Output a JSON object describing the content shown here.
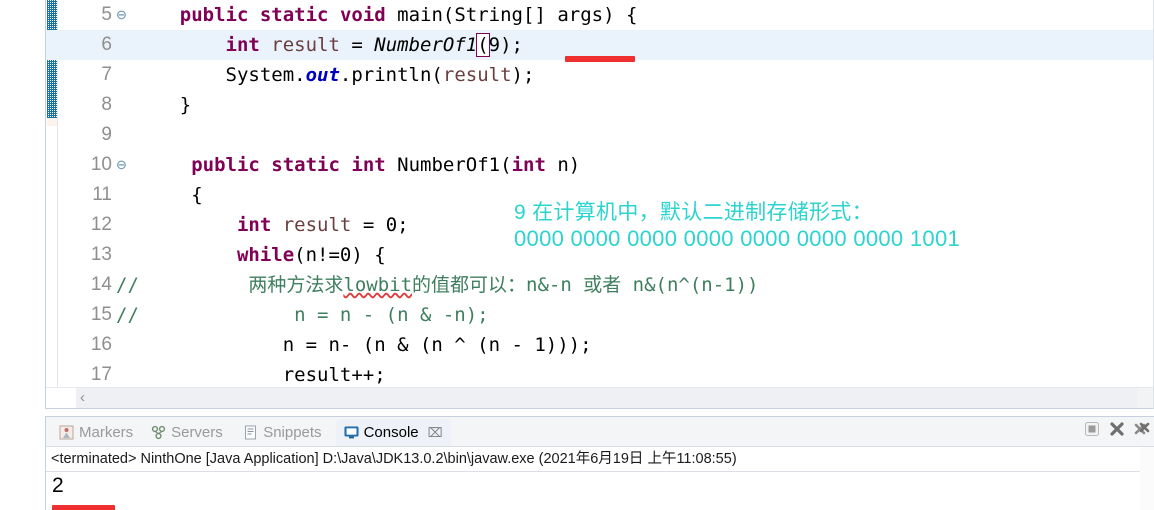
{
  "editor": {
    "lines": [
      {
        "num": "5",
        "fold": "⊖",
        "comment_slashes": "",
        "highlight": false,
        "tokens": [
          {
            "t": "    ",
            "c": "pln"
          },
          {
            "t": "public",
            "c": "kw"
          },
          {
            "t": " ",
            "c": "pln"
          },
          {
            "t": "static",
            "c": "kw"
          },
          {
            "t": " ",
            "c": "pln"
          },
          {
            "t": "void",
            "c": "kw"
          },
          {
            "t": " ",
            "c": "pln"
          },
          {
            "t": "main(String[] args) {",
            "c": "pln"
          }
        ]
      },
      {
        "num": "6",
        "fold": "",
        "comment_slashes": "",
        "highlight": true,
        "tokens": [
          {
            "t": "        ",
            "c": "pln"
          },
          {
            "t": "int",
            "c": "kw"
          },
          {
            "t": " ",
            "c": "pln"
          },
          {
            "t": "result",
            "c": "lvar"
          },
          {
            "t": " = ",
            "c": "pln"
          },
          {
            "t": "NumberOf1",
            "c": "mth"
          },
          {
            "t": "(",
            "c": "pln brk-box"
          },
          {
            "t": "9);",
            "c": "pln"
          }
        ]
      },
      {
        "num": "7",
        "fold": "",
        "comment_slashes": "",
        "highlight": false,
        "tokens": [
          {
            "t": "        System.",
            "c": "pln"
          },
          {
            "t": "out",
            "c": "fld"
          },
          {
            "t": ".println(",
            "c": "pln"
          },
          {
            "t": "result",
            "c": "lvar"
          },
          {
            "t": ");",
            "c": "pln"
          }
        ]
      },
      {
        "num": "8",
        "fold": "",
        "comment_slashes": "",
        "highlight": false,
        "tokens": [
          {
            "t": "    }",
            "c": "pln"
          }
        ]
      },
      {
        "num": "9",
        "fold": "",
        "comment_slashes": "",
        "highlight": false,
        "tokens": [
          {
            "t": "",
            "c": "pln"
          }
        ]
      },
      {
        "num": "10",
        "fold": "⊖",
        "comment_slashes": "",
        "highlight": false,
        "tokens": [
          {
            "t": "     ",
            "c": "pln"
          },
          {
            "t": "public",
            "c": "kw"
          },
          {
            "t": " ",
            "c": "pln"
          },
          {
            "t": "static",
            "c": "kw"
          },
          {
            "t": " ",
            "c": "pln"
          },
          {
            "t": "int",
            "c": "kw"
          },
          {
            "t": " ",
            "c": "pln"
          },
          {
            "t": "NumberOf1(",
            "c": "pln"
          },
          {
            "t": "int",
            "c": "kw"
          },
          {
            "t": " ",
            "c": "pln"
          },
          {
            "t": "n)",
            "c": "pln"
          }
        ]
      },
      {
        "num": "11",
        "fold": "",
        "comment_slashes": "",
        "highlight": false,
        "tokens": [
          {
            "t": "     {",
            "c": "pln"
          }
        ]
      },
      {
        "num": "12",
        "fold": "",
        "comment_slashes": "",
        "highlight": false,
        "tokens": [
          {
            "t": "         ",
            "c": "pln"
          },
          {
            "t": "int",
            "c": "kw"
          },
          {
            "t": " ",
            "c": "pln"
          },
          {
            "t": "result",
            "c": "lvar"
          },
          {
            "t": " = 0;",
            "c": "pln"
          }
        ]
      },
      {
        "num": "13",
        "fold": "",
        "comment_slashes": "",
        "highlight": false,
        "tokens": [
          {
            "t": "         ",
            "c": "pln"
          },
          {
            "t": "while",
            "c": "kw"
          },
          {
            "t": "(n!=0) {",
            "c": "pln"
          }
        ]
      },
      {
        "num": "14",
        "fold": "",
        "comment_slashes": "//",
        "highlight": false,
        "tokens": [
          {
            "t": "          两种方法求",
            "c": "cmt"
          },
          {
            "t": "lowbit",
            "c": "cmt squiggle"
          },
          {
            "t": "的值都可以：n&-n 或者 n&(n^(n-1))",
            "c": "cmt"
          }
        ]
      },
      {
        "num": "15",
        "fold": "",
        "comment_slashes": "//",
        "highlight": false,
        "tokens": [
          {
            "t": "              n = n - (n & -n);",
            "c": "cmt"
          }
        ]
      },
      {
        "num": "16",
        "fold": "",
        "comment_slashes": "",
        "highlight": false,
        "tokens": [
          {
            "t": "             n = n- (n & (n ^ (n - 1)));",
            "c": "pln"
          }
        ]
      },
      {
        "num": "17",
        "fold": "",
        "comment_slashes": "",
        "highlight": false,
        "tokens": [
          {
            "t": "             result++;",
            "c": "pln"
          }
        ]
      }
    ],
    "annotations": {
      "cyan_line1": "9 在计算机中，默认二进制存储形式：",
      "cyan_line2": "0000 0000 0000 0000 0000 0000 0000 1001",
      "cyan_color": "#2bd4cf",
      "red_color": "#f03030"
    },
    "scrollbar": {
      "left_arrow": "‹"
    }
  },
  "console_panel": {
    "tabs": [
      {
        "label": "Markers",
        "icon": "markers-icon",
        "active": false
      },
      {
        "label": "Servers",
        "icon": "servers-icon",
        "active": false
      },
      {
        "label": "Snippets",
        "icon": "snippets-icon",
        "active": false
      },
      {
        "label": "Console",
        "icon": "console-icon",
        "active": true
      }
    ],
    "close_glyph": "⌧",
    "toolbar": [
      {
        "name": "terminate-button",
        "glyph": "■"
      },
      {
        "name": "remove-launch-button",
        "glyph": "✖"
      },
      {
        "name": "remove-all-terminated-button",
        "glyph": "✖"
      }
    ],
    "launch_line": "<terminated> NinthOne [Java Application] D:\\Java\\JDK13.0.2\\bin\\javaw.exe (2021年6月19日 上午11:08:55)",
    "output": "2"
  }
}
